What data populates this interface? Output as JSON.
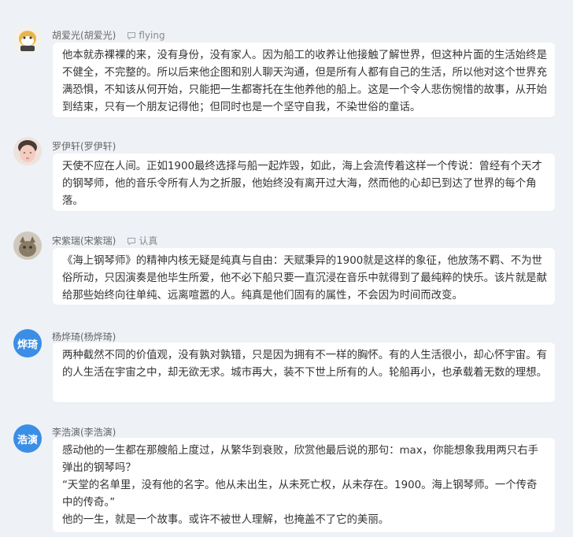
{
  "posts": [
    {
      "avatar_kind": "image",
      "author": "胡爱光(胡爱光)",
      "tag": "flying",
      "tag_icon": "chat-bubble-icon",
      "lines": [
        "他本就赤裸裸的来，没有身份，没有家人。因为船工的收养让他接触了解世界，但这种片面的生活始终是不健全，不完整的。所以后来他企图和别人聊天沟通，但是所有人都有自己的生活，所以他对这个世界充满恐惧，不知该从何开始，只能把一生都寄托在生他养他的船上。这是一个令人悲伤惋惜的故事，从开始到结束，只有一个朋友记得他；但同时也是一个坚守自我，不染世俗的童话。"
      ]
    },
    {
      "avatar_kind": "image",
      "author": "罗伊轩(罗伊轩)",
      "tag": "",
      "lines": [
        "天使不应在人间。正如1900最终选择与船一起炸毁，如此，海上会流传着这样一个传说：曾经有个天才的钢琴师，他的音乐令所有人为之折服，他始终没有离开过大海，然而他的心却已到达了世界的每个角落。"
      ]
    },
    {
      "avatar_kind": "image",
      "author": "宋紫瑞(宋紫瑞)",
      "tag": "认真",
      "tag_icon": "chat-bubble-icon",
      "lines": [
        "《海上钢琴师》的精神内核无疑是纯真与自由：天赋秉异的1900就是这样的象征，他放荡不羁、不为世俗所动，只因演奏是他毕生所爱，他不必下船只要一直沉浸在音乐中就得到了最纯粹的快乐。该片就是献给那些始终向往单纯、远离喧嚣的人。纯真是他们固有的属性，不会因为时间而改变。"
      ]
    },
    {
      "avatar_kind": "text",
      "avatar_text": "烨琦",
      "author": "杨烨琦(杨烨琦)",
      "tag": "",
      "lines": [
        "两种截然不同的价值观，没有孰对孰错，只是因为拥有不一样的胸怀。有的人生活很小，却心怀宇宙。有的人生活在宇宙之中，却无欲无求。城市再大，装不下世上所有的人。轮船再小，也承载着无数的理想。"
      ]
    },
    {
      "avatar_kind": "text",
      "avatar_text": "浩演",
      "author": "李浩演(李浩演)",
      "tag": "",
      "lines": [
        "感动他的一生都在那艘船上度过，从繁华到衰败，欣赏他最后说的那句：max，你能想象我用两只右手弹出的钢琴吗？",
        "“天堂的名单里，没有他的名字。他从未出生，从未死亡权，从未存在。1900。海上钢琴师。一个传奇中的传奇。”",
        "他的一生，就是一个故事。或许不被世人理解，也掩盖不了它的美丽。"
      ]
    }
  ],
  "colors": {
    "page_bg": "#eef1f5",
    "bubble_bg": "#ffffff",
    "avatar_text_bg": "#3a8ee6"
  }
}
